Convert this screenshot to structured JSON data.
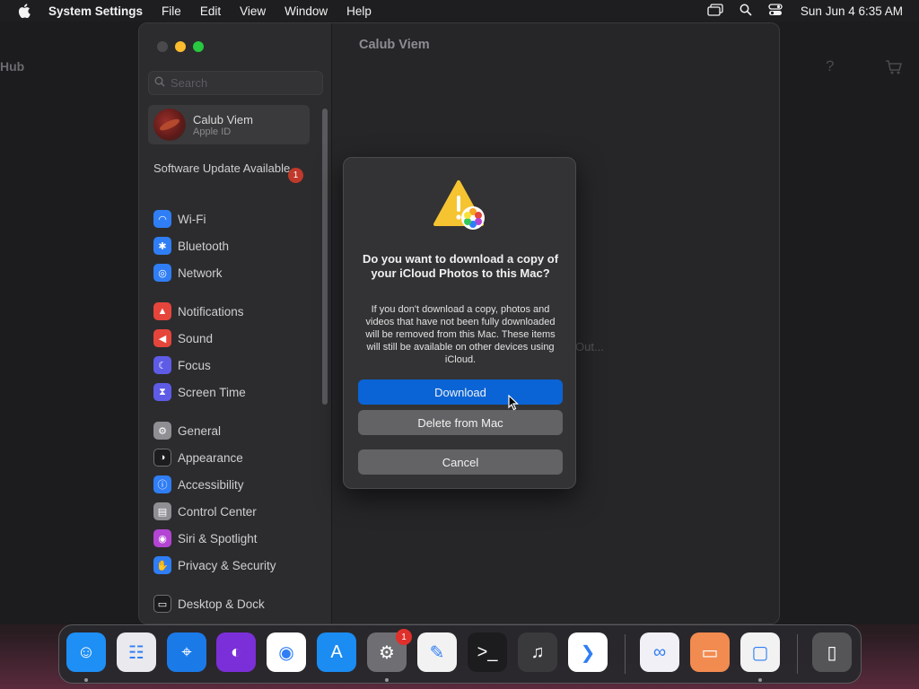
{
  "menubar": {
    "app_name": "System Settings",
    "menus": [
      "File",
      "Edit",
      "View",
      "Window",
      "Help"
    ],
    "clock": "Sun Jun 4  6:35 AM"
  },
  "background_app": {
    "title": "Hub",
    "help_icon": "?"
  },
  "settings": {
    "content_title": "Calub Viem",
    "content_ghost_text": "Out...",
    "search": {
      "placeholder": "Search"
    },
    "account": {
      "name": "Calub Viem",
      "subtitle": "Apple ID"
    },
    "software_update": {
      "label": "Software Update Available",
      "badge": "1"
    },
    "items": [
      {
        "label": "Wi-Fi",
        "icon": "wifi-icon",
        "color": "#2f7ef5"
      },
      {
        "label": "Bluetooth",
        "icon": "bluetooth-icon",
        "color": "#2f7ef5"
      },
      {
        "label": "Network",
        "icon": "globe-icon",
        "color": "#2f7ef5"
      },
      {
        "label": "Notifications",
        "icon": "bell-icon",
        "color": "#e5453b"
      },
      {
        "label": "Sound",
        "icon": "speaker-icon",
        "color": "#e5453b"
      },
      {
        "label": "Focus",
        "icon": "moon-icon",
        "color": "#5e5ce6"
      },
      {
        "label": "Screen Time",
        "icon": "hourglass-icon",
        "color": "#5e5ce6"
      },
      {
        "label": "General",
        "icon": "gear-icon",
        "color": "#8e8e93"
      },
      {
        "label": "Appearance",
        "icon": "appearance-icon",
        "color": "#1c1c1e"
      },
      {
        "label": "Accessibility",
        "icon": "accessibility-icon",
        "color": "#2f7ef5"
      },
      {
        "label": "Control Center",
        "icon": "control-center-icon",
        "color": "#8e8e93"
      },
      {
        "label": "Siri & Spotlight",
        "icon": "siri-icon",
        "color": "#b344d4"
      },
      {
        "label": "Privacy & Security",
        "icon": "hand-icon",
        "color": "#2f7ef5"
      },
      {
        "label": "Desktop & Dock",
        "icon": "dock-icon",
        "color": "#1c1c1e"
      }
    ]
  },
  "dialog": {
    "title": "Do you want to download a copy of your iCloud Photos to this Mac?",
    "body": "If you don't download a copy, photos and videos that have not been fully downloaded will be removed from this Mac. These items will still be available on other devices using iCloud.",
    "download_label": "Download",
    "delete_label": "Delete from Mac",
    "cancel_label": "Cancel"
  },
  "dock": {
    "apps": [
      {
        "name": "finder-icon",
        "color": "#1e8ff5",
        "running": true
      },
      {
        "name": "launchpad-icon",
        "color": "#e9e9ee",
        "running": false
      },
      {
        "name": "safari-icon",
        "color": "#1a7ae8",
        "running": false
      },
      {
        "name": "firefox-icon",
        "color": "#7b2fd8",
        "running": false
      },
      {
        "name": "chrome-icon",
        "color": "#ffffff",
        "running": false
      },
      {
        "name": "app-store-icon",
        "color": "#1a8cf2",
        "running": false
      },
      {
        "name": "system-settings-icon",
        "color": "#6e6e73",
        "running": true,
        "badge": "1"
      },
      {
        "name": "textedit-icon",
        "color": "#f2f2f2",
        "running": false
      },
      {
        "name": "terminal-icon",
        "color": "#1c1c1e",
        "running": false
      },
      {
        "name": "garageband-icon",
        "color": "#3a3a3c",
        "running": false
      },
      {
        "name": "vscode-icon",
        "color": "#ffffff",
        "running": false
      },
      {
        "name": "visual-studio-icon",
        "color": "#f2f0f7",
        "running": false
      },
      {
        "name": "remote-desktop-icon",
        "color": "#f28b50",
        "running": false
      },
      {
        "name": "device-app-icon",
        "color": "#f2f2f2",
        "running": true
      },
      {
        "name": "trash-icon",
        "color": "#555558",
        "running": false
      }
    ]
  }
}
